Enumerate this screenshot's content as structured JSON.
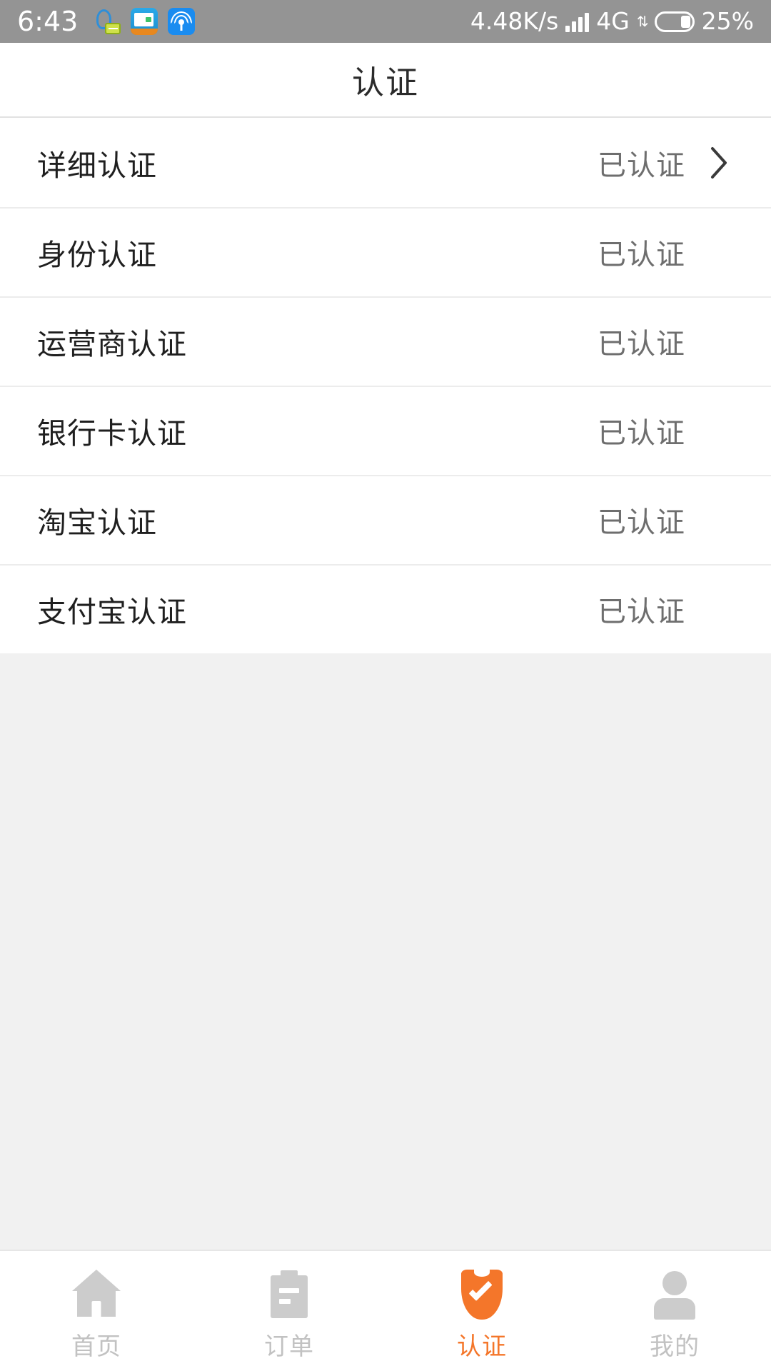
{
  "status_bar": {
    "time": "6:43",
    "net_speed": "4.48K/s",
    "network_type": "4G",
    "battery_percent": "25%",
    "icons": [
      "qq-icon",
      "wallet-app-icon",
      "hotspot-icon",
      "signal-icon",
      "data-transfer-icon",
      "battery-icon"
    ],
    "background_color": "#949494"
  },
  "header": {
    "title": "认证"
  },
  "cert_list": {
    "status_label": "已认证",
    "rows": [
      {
        "label": "详细认证",
        "status": "已认证",
        "has_chevron": true
      },
      {
        "label": "身份认证",
        "status": "已认证",
        "has_chevron": false
      },
      {
        "label": "运营商认证",
        "status": "已认证",
        "has_chevron": false
      },
      {
        "label": "银行卡认证",
        "status": "已认证",
        "has_chevron": false
      },
      {
        "label": "淘宝认证",
        "status": "已认证",
        "has_chevron": false
      },
      {
        "label": "支付宝认证",
        "status": "已认证",
        "has_chevron": false
      }
    ]
  },
  "bottom_nav": {
    "active_index": 2,
    "active_color": "#f4762a",
    "inactive_color": "#c2c2c2",
    "items": [
      {
        "label": "首页",
        "icon": "home-icon"
      },
      {
        "label": "订单",
        "icon": "clipboard-icon"
      },
      {
        "label": "认证",
        "icon": "shield-check-icon"
      },
      {
        "label": "我的",
        "icon": "person-icon"
      }
    ]
  }
}
